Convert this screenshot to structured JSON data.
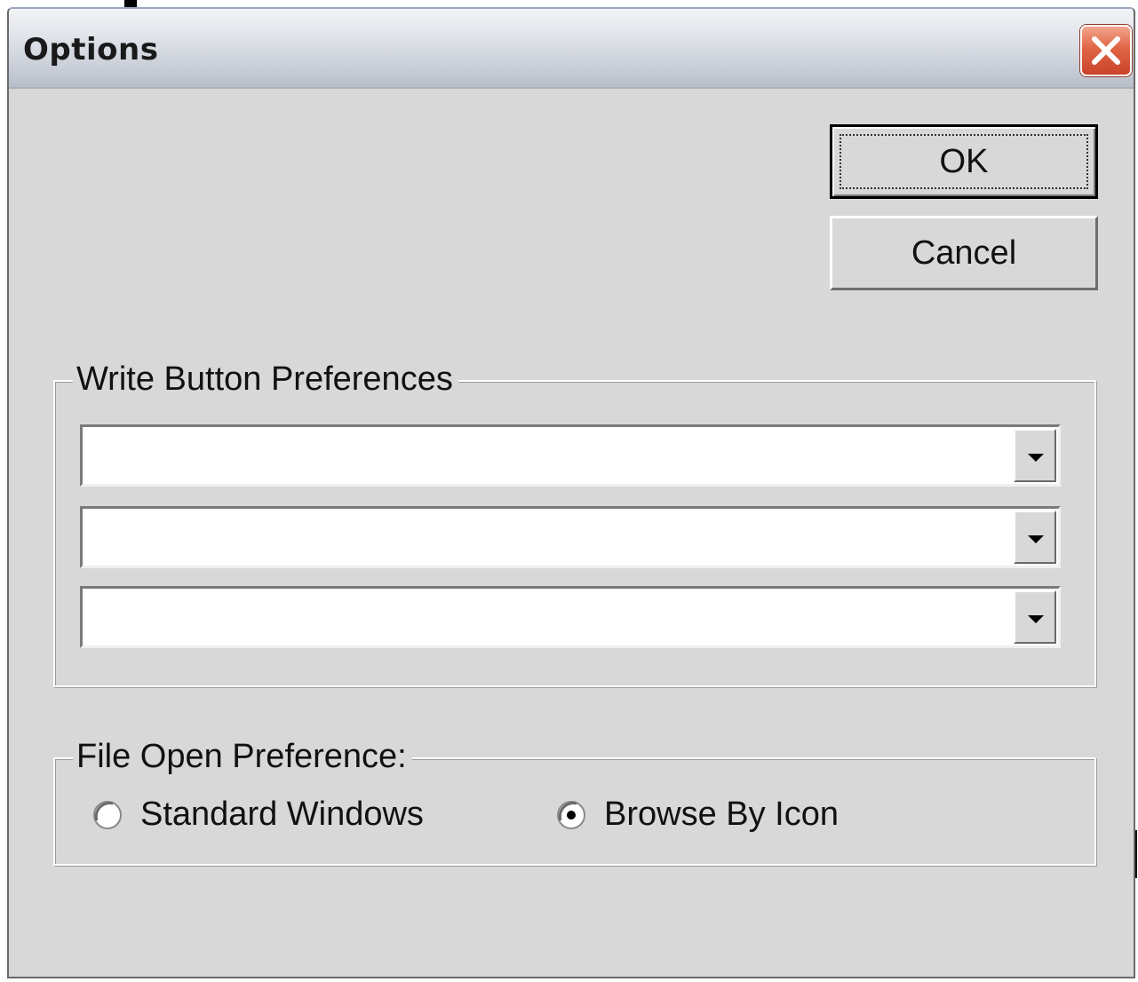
{
  "window": {
    "title": "Options"
  },
  "buttons": {
    "ok_label": "OK",
    "cancel_label": "Cancel"
  },
  "write_button_preferences": {
    "legend": "Write Button Preferences",
    "dropdowns": [
      {
        "value": ""
      },
      {
        "value": ""
      },
      {
        "value": ""
      }
    ]
  },
  "file_open_preference": {
    "legend": "File Open Preference:",
    "options": [
      {
        "label": "Standard Windows",
        "selected": false
      },
      {
        "label": "Browse By Icon",
        "selected": true
      }
    ]
  },
  "icons": {
    "close": "close-x-icon",
    "dropdown": "chevron-down-icon",
    "radio_unselected": "radio-empty-icon",
    "radio_selected": "radio-filled-icon"
  },
  "colors": {
    "dialog_background": "#d8d8d8",
    "close_button": "#e06545",
    "field_background": "#ffffff"
  }
}
